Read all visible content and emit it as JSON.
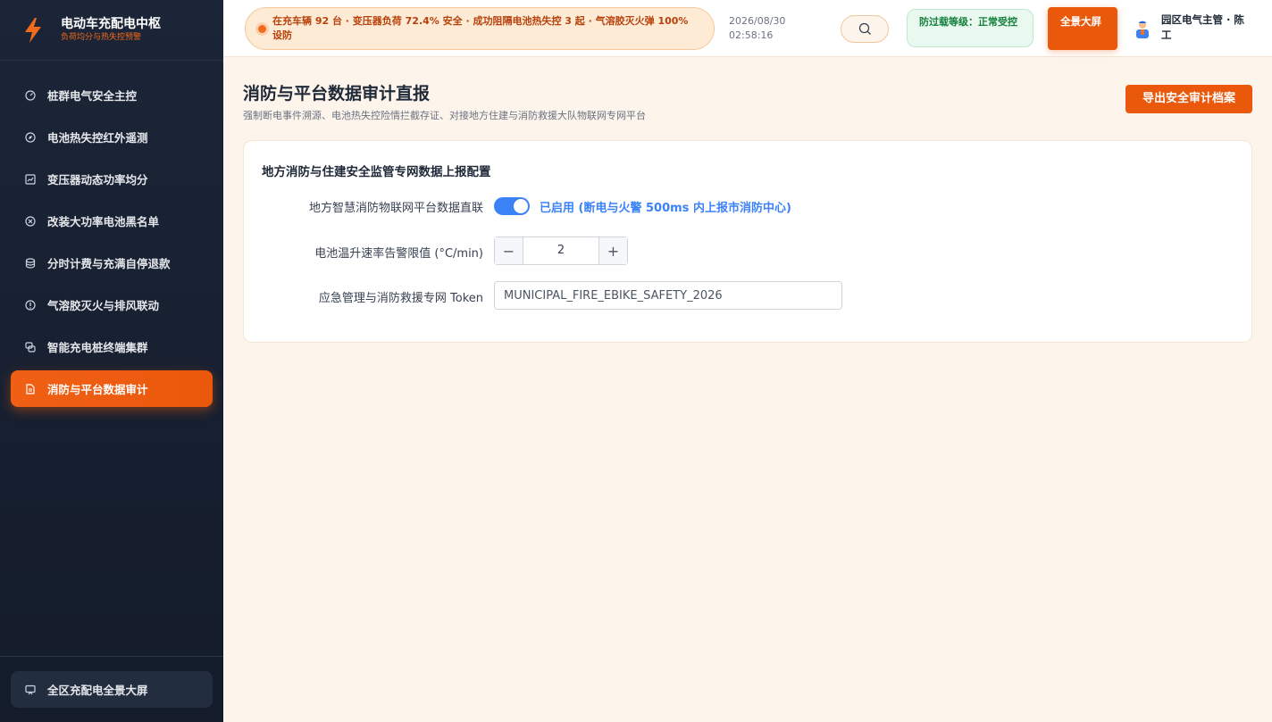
{
  "app": {
    "title": "电动车充配电中枢",
    "subtitle": "负荷均分与热失控预警"
  },
  "sidebar": {
    "items": [
      {
        "label": "桩群电气安全主控",
        "icon": "gauge-icon"
      },
      {
        "label": "电池热失控红外遥测",
        "icon": "compass-icon"
      },
      {
        "label": "变压器动态功率均分",
        "icon": "chart-icon"
      },
      {
        "label": "改装大功率电池黑名单",
        "icon": "block-icon"
      },
      {
        "label": "分时计费与充满自停退款",
        "icon": "database-icon"
      },
      {
        "label": "气溶胶灭火与排风联动",
        "icon": "alert-icon"
      },
      {
        "label": "智能充电桩终端集群",
        "icon": "cluster-icon"
      },
      {
        "label": "消防与平台数据审计",
        "icon": "document-icon",
        "active": true
      }
    ],
    "bottom_item": {
      "label": "全区充配电全景大屏",
      "icon": "monitor-icon"
    }
  },
  "header": {
    "ticker": "在充车辆 92 台 · 变压器负荷 72.4% 安全 · 成功阻隔电池热失控 3 起 · 气溶胶灭火弹 100% 设防",
    "date": "2026/08/30",
    "time": "02:58:16",
    "status": "防过载等级：正常受控",
    "fullscreen_button": "全景大屏",
    "user_name": "园区电气主管 · 陈工"
  },
  "page": {
    "title": "消防与平台数据审计直报",
    "subtitle": "强制断电事件溯源、电池热失控险情拦截存证、对接地方住建与消防救援大队物联网专网平台",
    "export_button": "导出安全审计档案"
  },
  "config_card": {
    "title": "地方消防与住建安全监管专网数据上报配置",
    "direct_link": {
      "label": "地方智慧消防物联网平台数据直联",
      "enabled": true,
      "status_text": "已启用 (断电与火警 500ms 内上报市消防中心)"
    },
    "temp_rate": {
      "label": "电池温升速率告警限值 (°C/min)",
      "value": "2",
      "minus": "−",
      "plus": "+"
    },
    "token": {
      "label": "应急管理与消防救援专网 Token",
      "value": "MUNICIPAL_FIRE_EBIKE_SAFETY_2026"
    }
  },
  "colors": {
    "accent": "#ea580c",
    "sidebar_bg": "#1b2537",
    "toggle_on": "#3b82f6",
    "status_green": "#15803d"
  }
}
